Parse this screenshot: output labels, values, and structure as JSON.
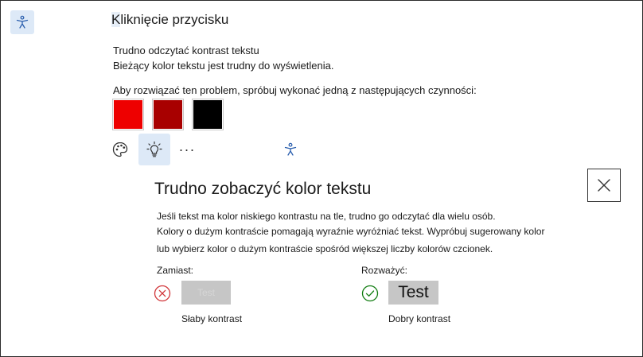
{
  "header": {
    "title_highlighted": "K",
    "title_rest": "liknięcie przycisku"
  },
  "issue": {
    "title": "Trudno odczytać kontrast tekstu",
    "description": "Bieżący kolor tekstu jest trudny do wyświetlenia.",
    "fix_prompt": "Aby rozwiązać ten problem, spróbuj wykonać jedną z następujących czynności:"
  },
  "swatches": [
    {
      "name": "red",
      "color": "#ee0000"
    },
    {
      "name": "dark-red",
      "color": "#a80000"
    },
    {
      "name": "black",
      "color": "#000000"
    }
  ],
  "toolbar": {
    "more_label": "···"
  },
  "panel": {
    "title": "Trudno zobaczyć kolor tekstu",
    "line1": "Jeśli tekst ma kolor niskiego kontrastu na tle, trudno go odczytać dla wielu osób.",
    "line2": "Kolory o dużym kontraście pomagają wyraźnie wyróżniać tekst. Wypróbuj sugerowany kolor",
    "line3": "lub wybierz kolor o dużym kontraście spośród większej liczby kolorów czcionek.",
    "instead_label": "Zamiast:",
    "consider_label": "Rozważyć:",
    "bad_sample_text": "Test",
    "good_sample_text": "Test",
    "bad_caption": "Słaby kontrast",
    "good_caption": "Dobry kontrast"
  },
  "colors": {
    "accent_bg": "#dde9f7",
    "accessibility_icon": "#2b5fae",
    "bad_status": "#d13438",
    "good_status": "#107c10"
  }
}
